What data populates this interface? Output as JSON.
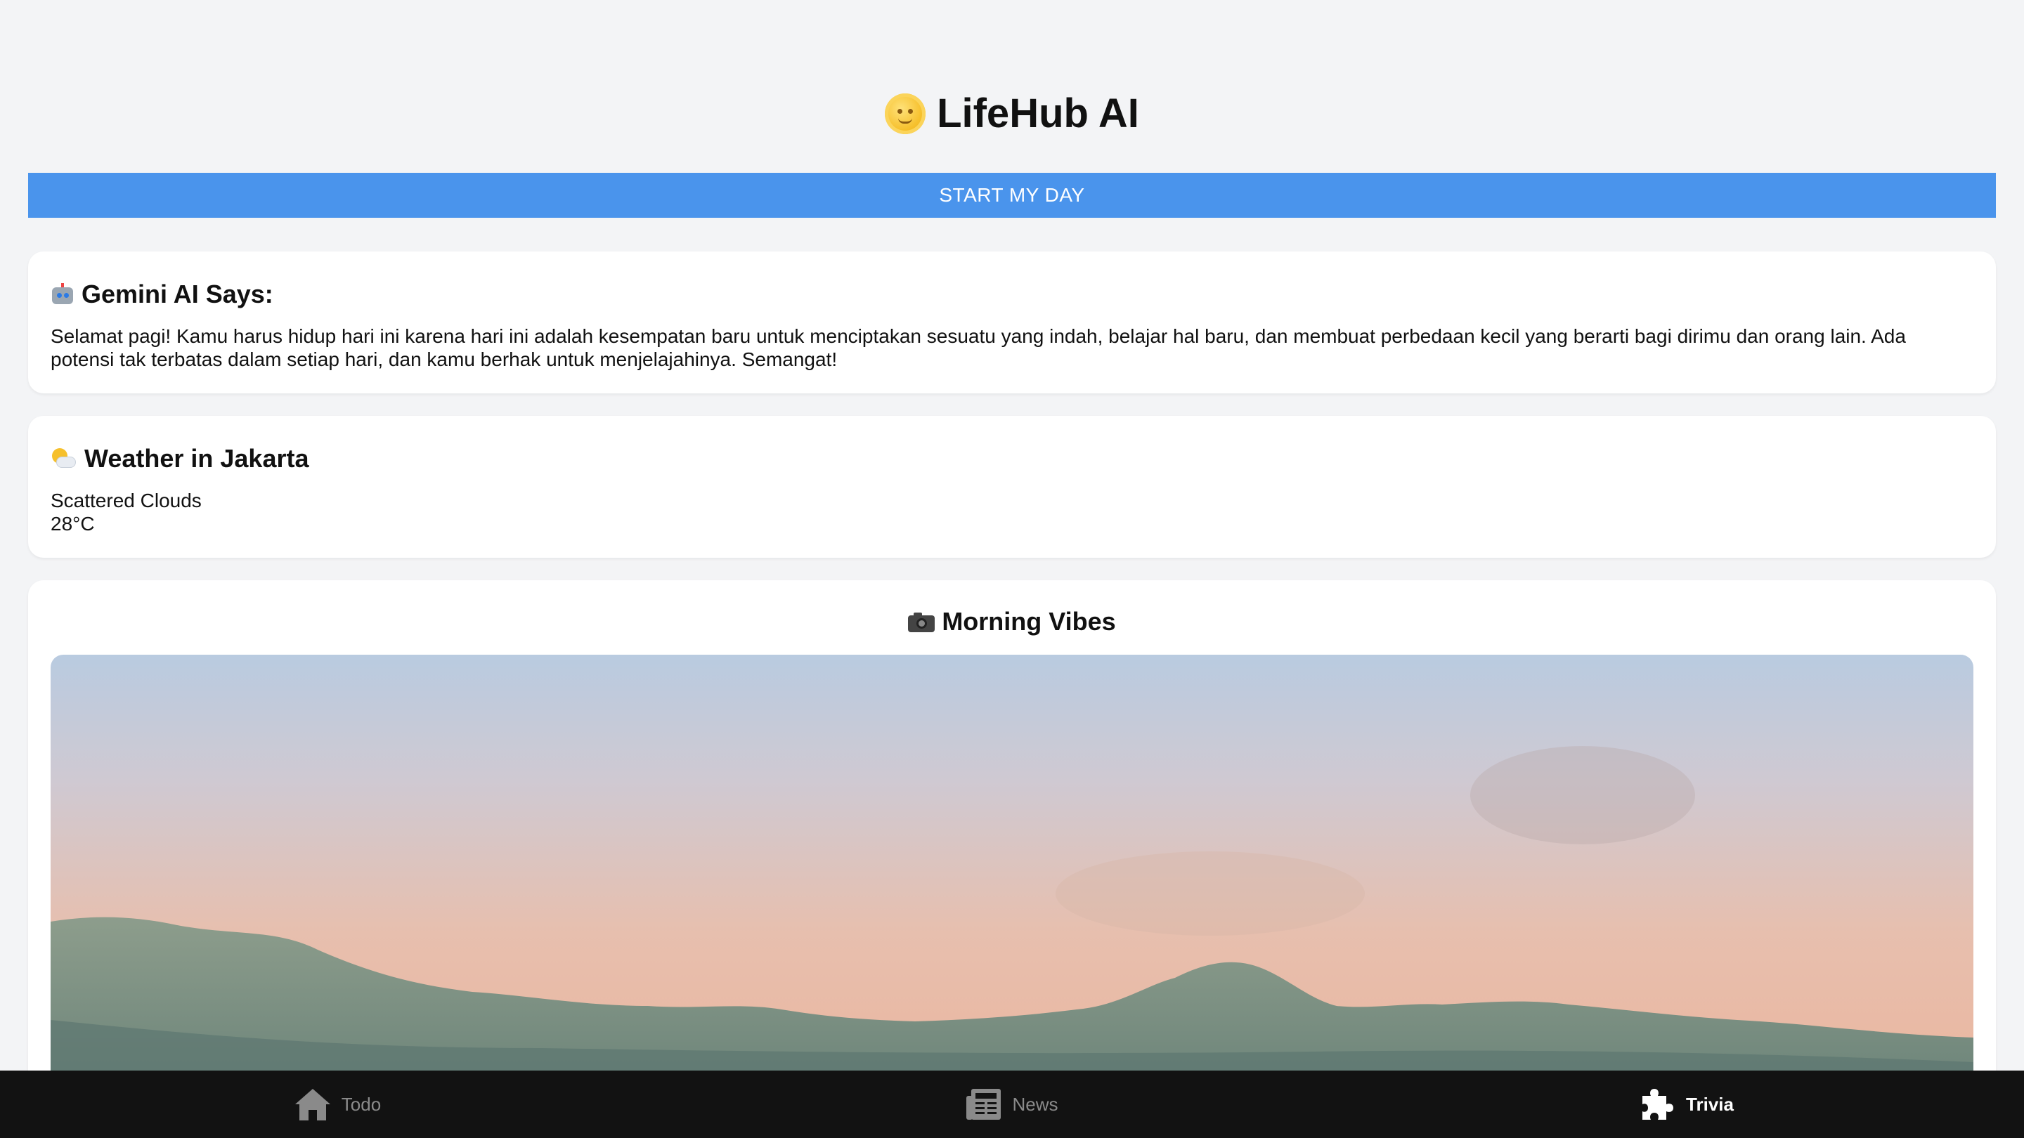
{
  "header": {
    "title": "LifeHub AI",
    "title_icon": "sun-face-icon"
  },
  "start_button": {
    "label": "START MY DAY",
    "color": "#4a94ec"
  },
  "gemini": {
    "icon": "robot-icon",
    "heading": "Gemini AI Says:",
    "message": "Selamat pagi! Kamu harus hidup hari ini karena hari ini adalah kesempatan baru untuk menciptakan sesuatu yang indah, belajar hal baru, dan membuat perbedaan kecil yang berarti bagi dirimu dan orang lain. Ada potensi tak terbatas dalam setiap hari, dan kamu berhak untuk menjelajahinya. Semangat!"
  },
  "weather": {
    "icon": "sun-behind-cloud-icon",
    "heading": "Weather in Jakarta",
    "condition": "Scattered Clouds",
    "temperature": "28°C"
  },
  "morning_vibes": {
    "icon": "camera-icon",
    "heading": "Morning Vibes",
    "image": "sunrise-mountain-photo"
  },
  "bottom_nav": {
    "items": [
      {
        "label": "Todo",
        "icon": "home-icon",
        "active": false
      },
      {
        "label": "News",
        "icon": "newspaper-icon",
        "active": false
      },
      {
        "label": "Trivia",
        "icon": "puzzle-icon",
        "active": true
      }
    ],
    "background": "#121212"
  }
}
